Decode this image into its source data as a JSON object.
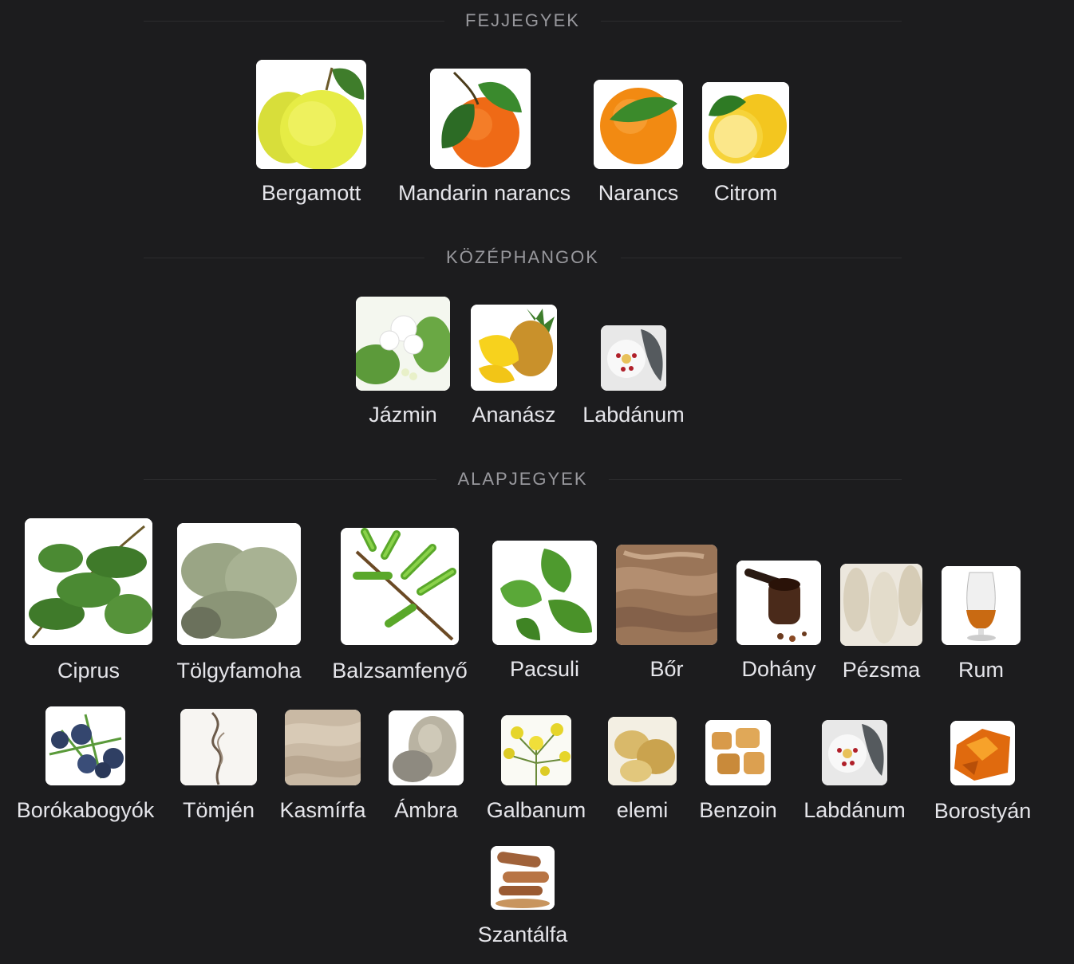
{
  "sections": {
    "top": {
      "title": "FEJJEGYEK",
      "notes": [
        {
          "label": "Bergamott",
          "icon": "bergamot-icon"
        },
        {
          "label": "Mandarin narancs",
          "icon": "mandarin-orange-icon"
        },
        {
          "label": "Narancs",
          "icon": "orange-icon"
        },
        {
          "label": "Citrom",
          "icon": "lemon-icon"
        }
      ]
    },
    "middle": {
      "title": "KÖZÉPHANGOK",
      "notes": [
        {
          "label": "Jázmin",
          "icon": "jasmine-icon"
        },
        {
          "label": "Ananász",
          "icon": "pineapple-icon"
        },
        {
          "label": "Labdánum",
          "icon": "labdanum-icon"
        }
      ]
    },
    "base": {
      "title": "ALAPJEGYEK",
      "notes": [
        {
          "label": "Ciprus",
          "icon": "cypress-icon"
        },
        {
          "label": "Tölgyfamoha",
          "icon": "oakmoss-icon"
        },
        {
          "label": "Balzsamfenyő",
          "icon": "balsam-fir-icon"
        },
        {
          "label": "Pacsuli",
          "icon": "patchouli-icon"
        },
        {
          "label": "Bőr",
          "icon": "leather-icon"
        },
        {
          "label": "Dohány",
          "icon": "tobacco-pipe-icon"
        },
        {
          "label": "Pézsma",
          "icon": "musk-icon"
        },
        {
          "label": "Rum",
          "icon": "rum-glass-icon"
        },
        {
          "label": "Borókabogyók",
          "icon": "juniper-berries-icon"
        },
        {
          "label": "Tömjén",
          "icon": "incense-smoke-icon"
        },
        {
          "label": "Kasmírfa",
          "icon": "cashmere-wood-icon"
        },
        {
          "label": "Ámbra",
          "icon": "ambergris-stone-icon"
        },
        {
          "label": "Galbanum",
          "icon": "galbanum-flower-icon"
        },
        {
          "label": "elemi",
          "icon": "elemi-resin-icon"
        },
        {
          "label": "Benzoin",
          "icon": "benzoin-resin-icon"
        },
        {
          "label": "Labdánum",
          "icon": "labdanum-icon"
        },
        {
          "label": "Borostyán",
          "icon": "amber-icon"
        },
        {
          "label": "Szantálfa",
          "icon": "sandalwood-icon"
        }
      ]
    }
  },
  "colors": {
    "background": "#1c1c1e",
    "section_title": "#98989d",
    "label": "#e5e5ea",
    "divider": "#2c2c2e"
  }
}
